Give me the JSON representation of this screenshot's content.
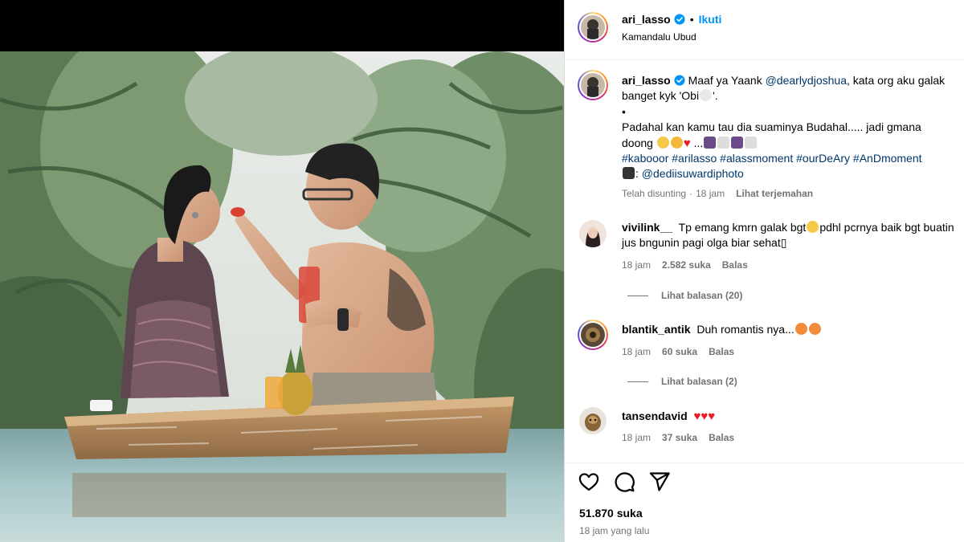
{
  "post": {
    "username": "ari_lasso",
    "follow_label": "Ikuti",
    "dot": "•",
    "location": "Kamandalu Ubud"
  },
  "caption": {
    "username": "ari_lasso",
    "text_1": "Maaf ya Yaank ",
    "mention_1": "@dearlydjoshua",
    "text_2": ", kata org aku galak banget kyk 'Obi",
    "text_2b": "'.",
    "bullet": "•",
    "text_3": "Padahal kan kamu tau dia suaminya Budahal..... jadi gmana doong ",
    "text_3b": " ...",
    "hashtags": "#kabooor #arilasso #alassmoment #ourDeAry #AnDmoment",
    "camera_prefix": ": ",
    "mention_2": "@dediisuwardiphoto",
    "edited_label": "Telah disunting",
    "time": "18 jam",
    "translate_label": "Lihat terjemahan"
  },
  "comments": [
    {
      "username": "vivilink__",
      "text_a": "Tp emang kmrn galak bgt",
      "text_b": "pdhl pcrnya baik bgt buatin jus bngunin pagi olga biar sehat",
      "tofu": "▯",
      "time": "18 jam",
      "likes": "2.582 suka",
      "reply": "Balas",
      "view_replies": "Lihat balasan (20)"
    },
    {
      "username": "blantik_antik",
      "text_a": "Duh romantis nya...",
      "time": "18 jam",
      "likes": "60 suka",
      "reply": "Balas",
      "view_replies": "Lihat balasan (2)"
    },
    {
      "username": "tansendavid",
      "hearts": "♥♥♥",
      "time": "18 jam",
      "likes": "37 suka",
      "reply": "Balas"
    }
  ],
  "actions": {
    "likes": "51.870 suka",
    "posted": "18 jam yang lalu",
    "icons": [
      "heart-icon",
      "comment-icon",
      "share-icon"
    ]
  },
  "colors": {
    "link": "#00376b",
    "follow": "#0095f6",
    "muted": "#737373",
    "verified": "#0095f6"
  }
}
